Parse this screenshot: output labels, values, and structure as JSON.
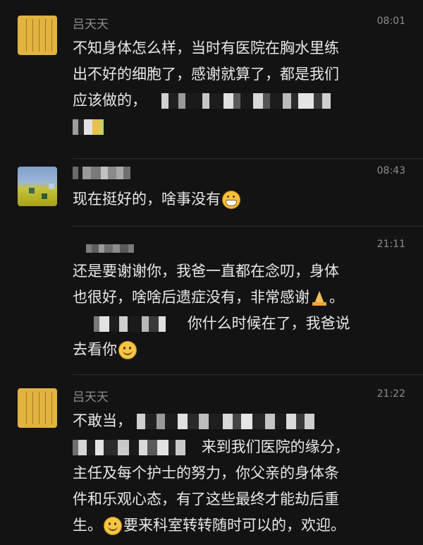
{
  "messages": [
    {
      "id": "msg1",
      "sender": "吕天天",
      "time": "08:01",
      "avatar": "calligraphy-avatar",
      "lines": [
        "不知身体怎么样，当时有医院在胸水里练",
        "出不好的细胞了，感谢就算了，都是我们",
        "应该做的，"
      ]
    },
    {
      "id": "msg2",
      "sender": "",
      "time": "08:43",
      "avatar": "landscape-photo-avatar",
      "lines": [
        "现在挺好的，啥事没有"
      ]
    },
    {
      "id": "msg3",
      "sender": "",
      "time": "21:11",
      "lines": [
        "还是要谢谢你，我爸一直都在念叨，身体",
        "也很好，啥啥后遗症没有，非常感谢",
        "你什么时候在了，我爸说",
        "去看你"
      ]
    },
    {
      "id": "msg4",
      "sender": "吕天天",
      "time": "21:22",
      "avatar": "calligraphy-avatar",
      "lines": [
        "不敢当，",
        "来到我们医院的缘分，",
        "主任及每个护士的努力，你父亲的身体条",
        "件和乐观心态，有了这些最终才能劫后重",
        "生。",
        "要来科室转转随时可以的，欢迎。"
      ]
    }
  ],
  "colors": {
    "background": "#131313",
    "text": "#e8e8e8",
    "meta": "#8d8d8d"
  },
  "icons": [
    "grinning-face-emoji",
    "praying-hands-emoji",
    "smiling-face-emoji"
  ]
}
